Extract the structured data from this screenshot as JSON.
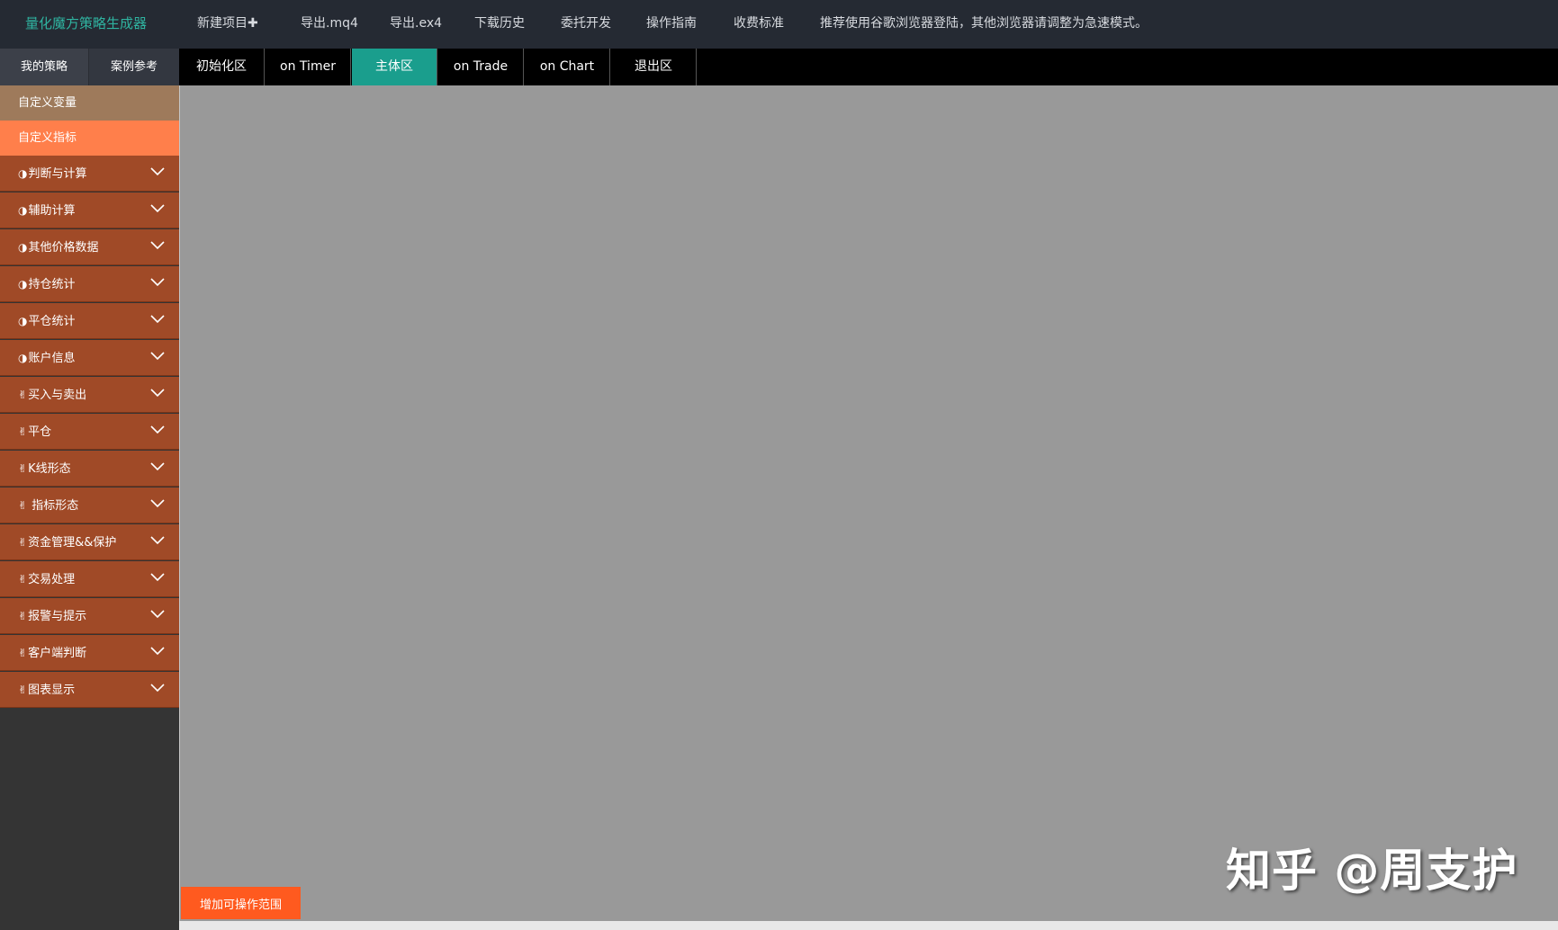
{
  "topbar": {
    "brand": "量化魔方策略生成器",
    "nav": [
      "新建项目✚",
      "导出.mq4",
      "导出.ex4",
      "下载历史",
      "委托开发",
      "操作指南",
      "收费标准"
    ],
    "notice": "推荐使用谷歌浏览器登陆，其他浏览器请调整为急速模式。"
  },
  "sidebar": {
    "tabs": [
      "我的策略",
      "案例参考"
    ],
    "flat_items": [
      "自定义变量",
      "自定义指标"
    ],
    "groups": [
      {
        "icon": "◑",
        "label": "判断与计算"
      },
      {
        "icon": "◑",
        "label": "辅助计算"
      },
      {
        "icon": "◑",
        "label": "其他价格数据"
      },
      {
        "icon": "◑",
        "label": "持仓统计"
      },
      {
        "icon": "◑",
        "label": "平仓统计"
      },
      {
        "icon": "◑",
        "label": "账户信息"
      },
      {
        "icon": "✌",
        "label": "买入与卖出"
      },
      {
        "icon": "✌",
        "label": "平仓"
      },
      {
        "icon": "✌",
        "label": "K线形态"
      },
      {
        "icon": "✌",
        "label": " 指标形态"
      },
      {
        "icon": "✌",
        "label": "资金管理&&保护"
      },
      {
        "icon": "✌",
        "label": "交易处理"
      },
      {
        "icon": "✌",
        "label": "报警与提示"
      },
      {
        "icon": "✌",
        "label": "客户端判断"
      },
      {
        "icon": "✌",
        "label": "图表显示"
      }
    ]
  },
  "content_tabs": {
    "items": [
      "初始化区",
      "on Timer",
      "主体区",
      "on Trade",
      "on Chart",
      "退出区"
    ],
    "active": "主体区"
  },
  "canvas": {
    "add_range_button": "增加可操作范围"
  },
  "watermark": "知乎 @周支护",
  "colors": {
    "accent": "#1a9e8d",
    "brand_text": "#2fb3a0",
    "menu_group": "#a04a27",
    "var_item": "#9e7a5b",
    "indicator_item": "#ff7f4b",
    "add_button": "#ff5a1f"
  }
}
